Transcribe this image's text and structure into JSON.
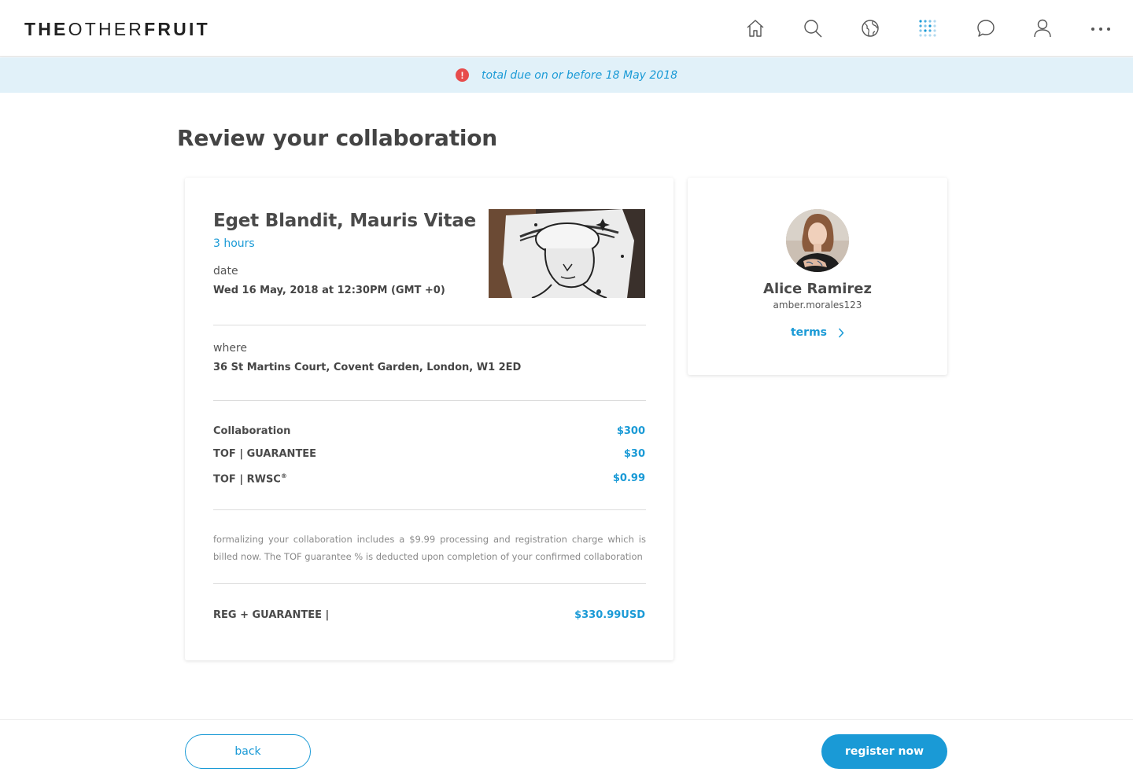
{
  "header": {
    "logo_part1": "THE",
    "logo_part2": "OTHER",
    "logo_part3": "FRUIT",
    "nav_icons": [
      "home-icon",
      "search-icon",
      "globe-icon",
      "grid-dots-icon",
      "chat-icon",
      "user-icon",
      "more-icon"
    ]
  },
  "banner": {
    "alert_glyph": "!",
    "text": "total due on or before 18 May 2018"
  },
  "page_title": "Review your collaboration",
  "event": {
    "title": "Eget Blandit, Mauris Vitae",
    "duration": "3 hours",
    "date_label": "date",
    "date_value": "Wed 16 May, 2018 at 12:30PM (GMT +0)",
    "where_label": "where",
    "where_value": "36 St Martins Court, Covent Garden, London, W1 2ED"
  },
  "pricing": {
    "rows": [
      {
        "name": "Collaboration",
        "price": "$300"
      },
      {
        "name": "TOF | GUARANTEE",
        "price": "$30"
      },
      {
        "name": "TOF | RWSC",
        "sup": "®",
        "price": "$0.99"
      }
    ],
    "note": "formalizing your collaboration includes a $9.99 processing and registration charge which is billed now. The TOF guarantee % is deducted upon completion of your confirmed collaboration",
    "total_label": "REG + GUARANTEE |",
    "total_value": "$330.99USD"
  },
  "profile": {
    "name": "Alice Ramirez",
    "username": "amber.morales123",
    "terms_label": "terms"
  },
  "footer": {
    "back_label": "back",
    "register_label": "register now"
  },
  "colors": {
    "accent": "#1a9ad6",
    "banner_bg": "#e1f1f9",
    "alert": "#e74c4c"
  }
}
